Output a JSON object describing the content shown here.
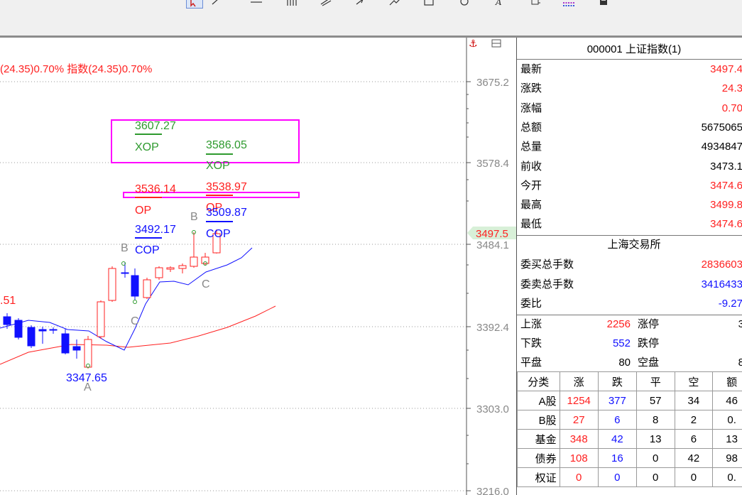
{
  "toolbar": {
    "icons": [
      "cursor-select-icon",
      "line-tool-icon",
      "horizontal-line-icon",
      "bar-tool-icon",
      "channel-icon",
      "arrow-tool-icon",
      "trend-tool-icon",
      "rectangle-tool-icon",
      "circle-tool-icon",
      "text-tool-icon",
      "copy-icon",
      "dotted-line-icon",
      "save-icon"
    ]
  },
  "chart": {
    "header_text": "(24.35)0.70%  指数(24.35)0.70%",
    "price_axis": [
      "3675.2",
      "3578.4",
      "3484.1",
      "3392.4",
      "3303.0",
      "3216.0"
    ],
    "current_price": "3497.5",
    "annotations": {
      "high_xop1": "3607.27",
      "xop_label1": "XOP",
      "high_xop2": "3586.05",
      "xop_label2": "XOP",
      "op_val1": "3536.14",
      "op_label1": "OP",
      "op_val2": "3538.97",
      "op_label2": "OP",
      "cop_val1": "3492.17",
      "cop_label1": "COP",
      "cop_val2": "3509.87",
      "cop_label2": "COP",
      "point_b1": "B",
      "point_b2": "B",
      "point_c1": "C",
      "point_c2": "C",
      "point_a": "A",
      "low_val": "3347.65",
      "left_val": ".51"
    },
    "colors": {
      "up": "#ff2020",
      "down": "#1010ff",
      "ma5": "#1010ff",
      "ma10": "#ff2020",
      "box": "#ff00ff",
      "annot_green": "#2e9a2e",
      "annot_gray": "#888888"
    }
  },
  "quote": {
    "title": "000001 上证指数(1)",
    "rows": [
      {
        "label": "最新",
        "value": "3497.4",
        "color": "red"
      },
      {
        "label": "涨跌",
        "value": "24.3",
        "color": "red"
      },
      {
        "label": "涨幅",
        "value": "0.70",
        "color": "red"
      },
      {
        "label": "总额",
        "value": "5675065",
        "color": "blk"
      },
      {
        "label": "总量",
        "value": "4934847",
        "color": "blk"
      },
      {
        "label": "前收",
        "value": "3473.1",
        "color": "blk"
      },
      {
        "label": "今开",
        "value": "3474.6",
        "color": "red"
      },
      {
        "label": "最高",
        "value": "3499.8",
        "color": "red"
      },
      {
        "label": "最低",
        "value": "3474.6",
        "color": "red"
      }
    ],
    "exchange_title": "上海交易所",
    "orders": [
      {
        "label": "委买总手数",
        "value": "2836603",
        "color": "red"
      },
      {
        "label": "委卖总手数",
        "value": "3416433",
        "color": "blue"
      },
      {
        "label": "委比",
        "value": "-9.27",
        "color": "blue"
      }
    ],
    "updown": [
      {
        "label": "上涨",
        "value": "2256",
        "vcolor": "red",
        "label2": "涨停",
        "value2": "3"
      },
      {
        "label": "下跌",
        "value": "552",
        "vcolor": "blue",
        "label2": "跌停",
        "value2": ""
      },
      {
        "label": "平盘",
        "value": "80",
        "vcolor": "blk",
        "label2": "空盘",
        "value2": "8"
      }
    ],
    "table": {
      "headers": [
        "分类",
        "涨",
        "跌",
        "平",
        "空",
        "额"
      ],
      "rows": [
        [
          "A股",
          "1254",
          "377",
          "57",
          "34",
          "46"
        ],
        [
          "B股",
          "27",
          "6",
          "8",
          "2",
          "0."
        ],
        [
          "基金",
          "348",
          "42",
          "13",
          "6",
          "13"
        ],
        [
          "债券",
          "108",
          "16",
          "0",
          "42",
          "98"
        ],
        [
          "权证",
          "0",
          "0",
          "0",
          "0",
          "0."
        ]
      ]
    }
  }
}
